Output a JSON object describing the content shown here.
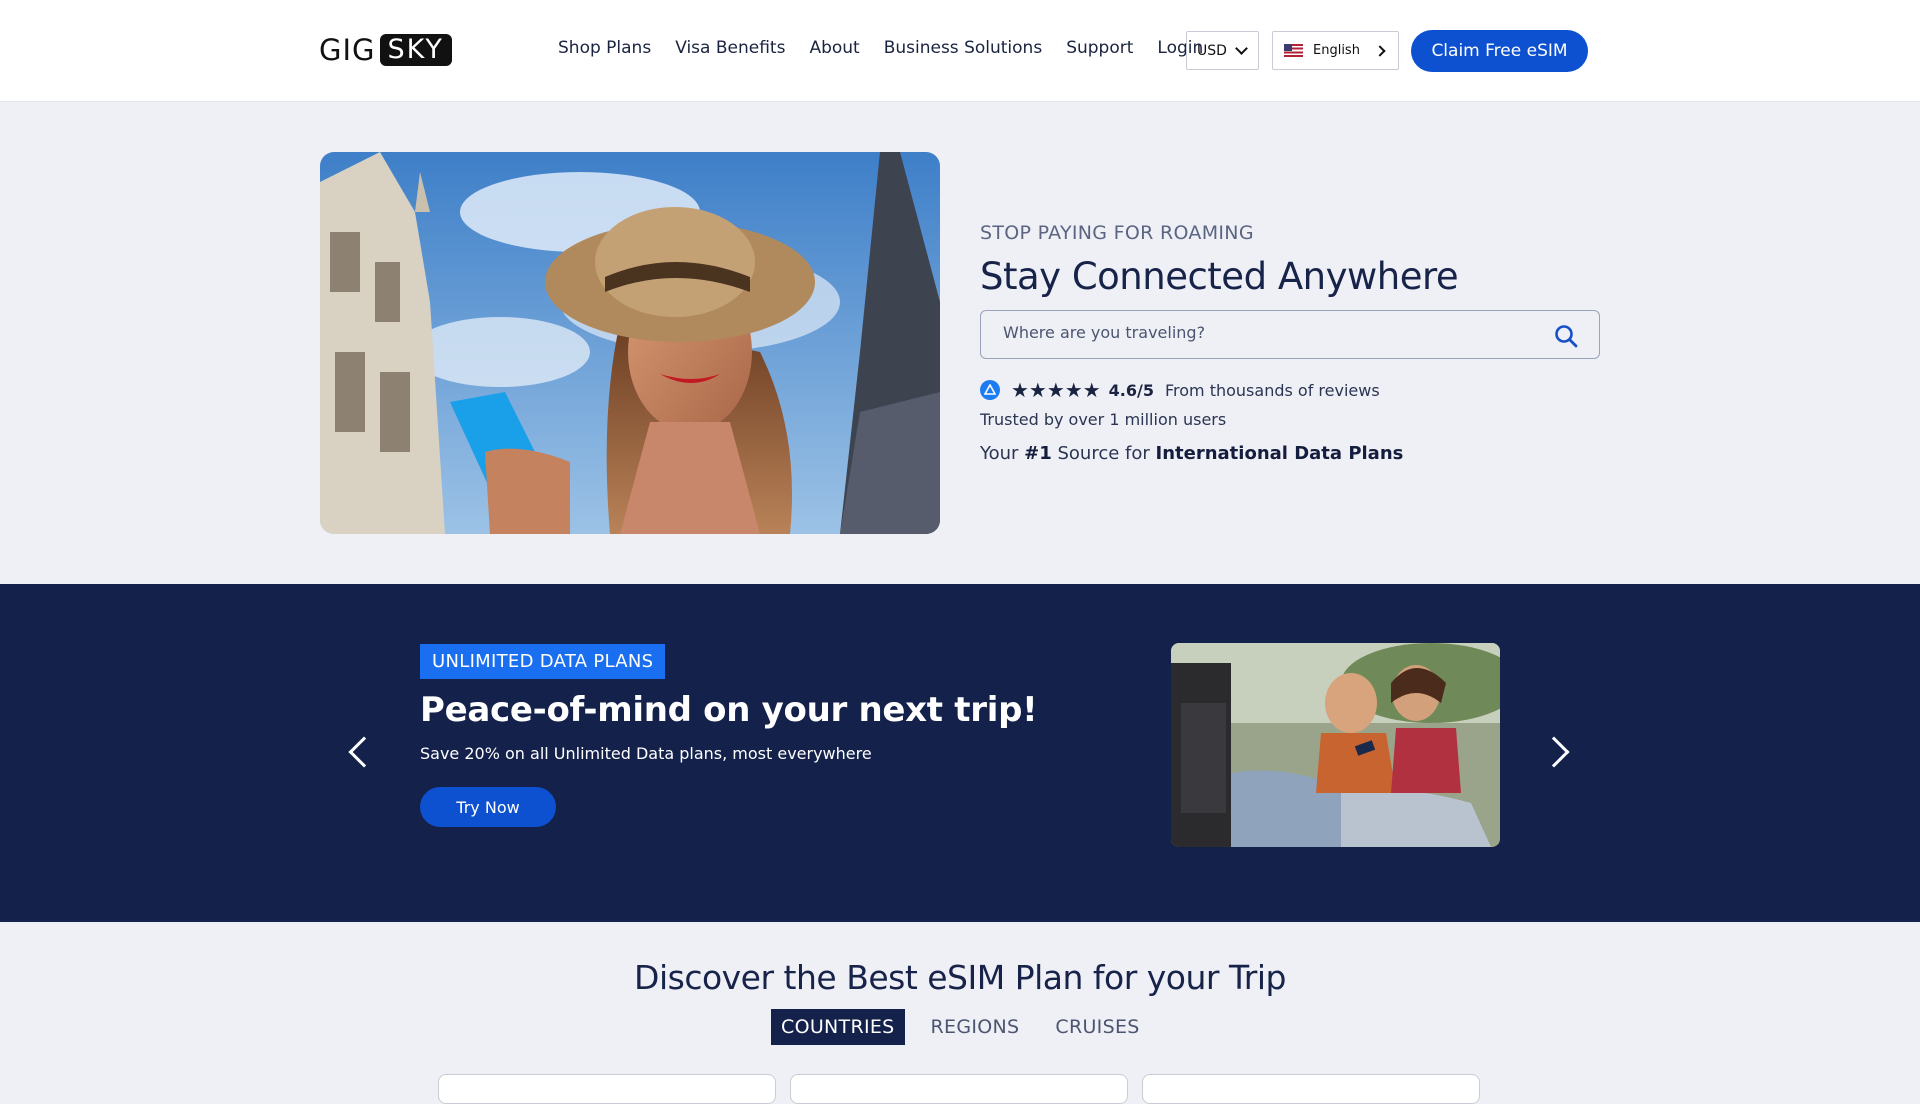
{
  "nav": {
    "logo_left": "GIG",
    "logo_right": "SKY",
    "links": [
      "Shop Plans",
      "Visa Benefits",
      "About",
      "Business Solutions",
      "Support",
      "Login"
    ],
    "currency": "USD",
    "language": "English",
    "cta": "Claim Free eSIM"
  },
  "hero": {
    "eyebrow": "STOP PAYING FOR ROAMING",
    "title": "Stay Connected Anywhere",
    "search_placeholder": "Where are you traveling?",
    "stars": "★★★★★",
    "score": "4.6/5",
    "reviews": "From thousands of reviews",
    "trusted": "Trusted by over 1 million users",
    "source_prefix": "Your ",
    "source_rank": "#1",
    "source_mid": " Source for ",
    "source_emph": "International Data Plans"
  },
  "promo": {
    "tag": "UNLIMITED DATA PLANS",
    "title": "Peace-of-mind on your next trip!",
    "subtitle": "Save 20% on all Unlimited Data plans, most everywhere",
    "button": "Try Now"
  },
  "discover": {
    "title": "Discover the Best eSIM Plan for your Trip",
    "tabs": [
      "COUNTRIES",
      "REGIONS",
      "CRUISES"
    ],
    "active_tab": "COUNTRIES"
  },
  "colors": {
    "brand_blue": "#0d50d0",
    "navy": "#13214b",
    "tag_blue": "#1a6ff0",
    "page_bg": "#eff0f6"
  },
  "icons": [
    "search-icon",
    "chevron-down-icon",
    "chevron-right-icon",
    "us-flag-icon",
    "app-store-icon",
    "carousel-prev-icon",
    "carousel-next-icon"
  ]
}
